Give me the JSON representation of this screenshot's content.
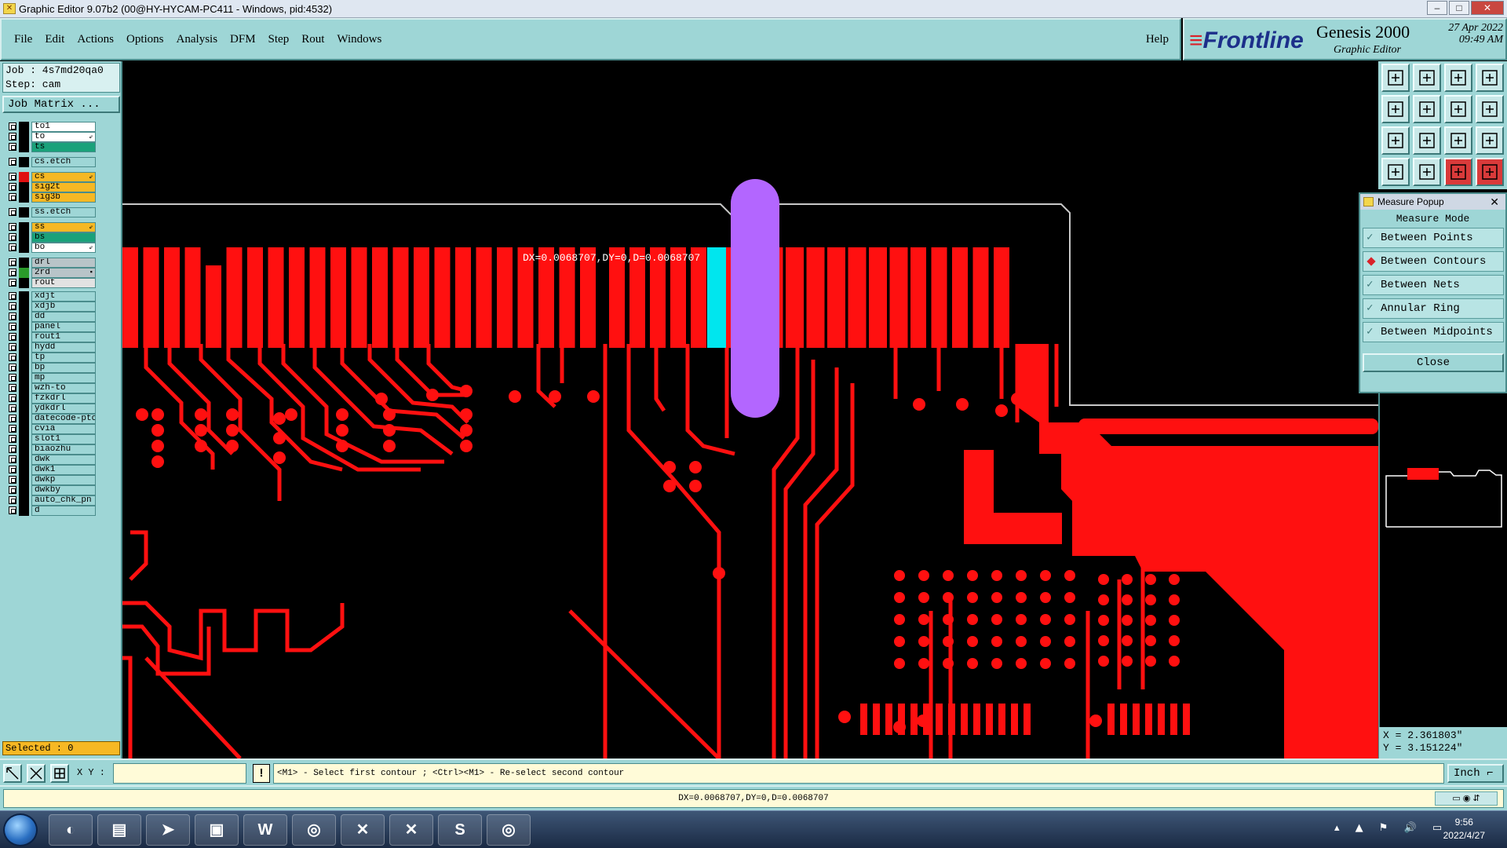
{
  "window": {
    "title": "Graphic Editor 9.07b2 (00@HY-HYCAM-PC411 - Windows, pid:4532)",
    "controls": [
      "–",
      "□",
      "✕"
    ]
  },
  "menu": {
    "items": [
      "File",
      "Edit",
      "Actions",
      "Options",
      "Analysis",
      "DFM",
      "Step",
      "Rout",
      "Windows"
    ],
    "help": "Help"
  },
  "brand": {
    "logo": "Frontline",
    "product": "Genesis 2000",
    "subtitle": "Graphic Editor",
    "date": "27 Apr 2022",
    "time": "09:49 AM"
  },
  "job": {
    "job_line": "Job : 4s7md20qa0",
    "step_line": "Step: cam",
    "matrix_button": "Job Matrix ..."
  },
  "layers": [
    {
      "name": "to1",
      "color": "#ffffff",
      "swatch": "#000000",
      "arrow": ""
    },
    {
      "name": "to",
      "color": "#ffffff",
      "swatch": "#000000",
      "arrow": "⇙"
    },
    {
      "name": "ts",
      "color": "#1aa17a",
      "swatch": "#000000",
      "arrow": ""
    },
    {
      "name": "cs.etch",
      "color": "#9ed6d6",
      "swatch": "#000000",
      "arrow": ""
    },
    {
      "name": "cs",
      "color": "#f6b824",
      "swatch": "#e01010",
      "arrow": "⇙"
    },
    {
      "name": "sig2t",
      "color": "#f6b824",
      "swatch": "#000000",
      "arrow": ""
    },
    {
      "name": "sig3b",
      "color": "#f6b824",
      "swatch": "#000000",
      "arrow": ""
    },
    {
      "name": "ss.etch",
      "color": "#9ed6d6",
      "swatch": "#000000",
      "arrow": ""
    },
    {
      "name": "ss",
      "color": "#f6b824",
      "swatch": "#000000",
      "arrow": "⇙"
    },
    {
      "name": "bs",
      "color": "#1aa17a",
      "swatch": "#000000",
      "arrow": ""
    },
    {
      "name": "bo",
      "color": "#ffffff",
      "swatch": "#000000",
      "arrow": "⇙"
    },
    {
      "name": "drl",
      "color": "#b8c4c8",
      "swatch": "#000000",
      "arrow": ""
    },
    {
      "name": "2rd",
      "color": "#b8c4c8",
      "swatch": "#2a9a2a",
      "arrow": "▪"
    },
    {
      "name": "rout",
      "color": "#e2e2e2",
      "swatch": "#000000",
      "arrow": ""
    },
    {
      "name": "xdjt",
      "color": "#9ed6d6",
      "swatch": "#000000",
      "arrow": ""
    },
    {
      "name": "xdjb",
      "color": "#9ed6d6",
      "swatch": "#000000",
      "arrow": ""
    },
    {
      "name": "dd",
      "color": "#9ed6d6",
      "swatch": "#000000",
      "arrow": ""
    },
    {
      "name": "panel",
      "color": "#9ed6d6",
      "swatch": "#000000",
      "arrow": ""
    },
    {
      "name": "rout1",
      "color": "#9ed6d6",
      "swatch": "#000000",
      "arrow": ""
    },
    {
      "name": "hydd",
      "color": "#9ed6d6",
      "swatch": "#000000",
      "arrow": ""
    },
    {
      "name": "tp",
      "color": "#9ed6d6",
      "swatch": "#000000",
      "arrow": ""
    },
    {
      "name": "bp",
      "color": "#9ed6d6",
      "swatch": "#000000",
      "arrow": ""
    },
    {
      "name": "mp",
      "color": "#9ed6d6",
      "swatch": "#000000",
      "arrow": ""
    },
    {
      "name": "wzh-to",
      "color": "#9ed6d6",
      "swatch": "#000000",
      "arrow": ""
    },
    {
      "name": "fzkdrl",
      "color": "#9ed6d6",
      "swatch": "#000000",
      "arrow": ""
    },
    {
      "name": "ydkdrl",
      "color": "#9ed6d6",
      "swatch": "#000000",
      "arrow": ""
    },
    {
      "name": "datecode-pto",
      "color": "#9ed6d6",
      "swatch": "#000000",
      "arrow": ""
    },
    {
      "name": "cvia",
      "color": "#9ed6d6",
      "swatch": "#000000",
      "arrow": ""
    },
    {
      "name": "slot1",
      "color": "#9ed6d6",
      "swatch": "#000000",
      "arrow": ""
    },
    {
      "name": "biaozhu",
      "color": "#9ed6d6",
      "swatch": "#000000",
      "arrow": ""
    },
    {
      "name": "dwk",
      "color": "#9ed6d6",
      "swatch": "#000000",
      "arrow": ""
    },
    {
      "name": "dwk1",
      "color": "#9ed6d6",
      "swatch": "#000000",
      "arrow": ""
    },
    {
      "name": "dwkp",
      "color": "#9ed6d6",
      "swatch": "#000000",
      "arrow": ""
    },
    {
      "name": "dwkby",
      "color": "#9ed6d6",
      "swatch": "#000000",
      "arrow": ""
    },
    {
      "name": "auto_chk_pn",
      "color": "#9ed6d6",
      "swatch": "#000000",
      "arrow": ""
    },
    {
      "name": "d",
      "color": "#9ed6d6",
      "swatch": "#000000",
      "arrow": ""
    }
  ],
  "selected_label": "Selected : 0",
  "canvas": {
    "measure_text": "DX=0.0068707,DY=0,D=0.0068707",
    "colors": {
      "copper": "#ff1010",
      "highlight": "#00e6ee",
      "slot": "#b366ff",
      "outline": "#c8c8c8"
    }
  },
  "measure_popup": {
    "title": "Measure Popup",
    "mode_label": "Measure Mode",
    "options": [
      {
        "label": "Between Points",
        "selected": false
      },
      {
        "label": "Between Contours",
        "selected": true
      },
      {
        "label": "Between Nets",
        "selected": false
      },
      {
        "label": "Annular Ring",
        "selected": false
      },
      {
        "label": "Between Midpoints",
        "selected": false
      }
    ],
    "close_label": "Close"
  },
  "coords": {
    "x": "X = 2.361803\"",
    "y": "Y = 3.151224\""
  },
  "command": {
    "xy_label": "X Y :",
    "xy_value": "",
    "hint": "<M1> - Select first contour ; <Ctrl><M1> - Re-select second contour",
    "unit": "Inch"
  },
  "status_message": "DX=0.0068707,DY=0,D=0.0068707",
  "taskbar": {
    "apps": [
      "shell",
      "notepad",
      "feather",
      "save",
      "W",
      "eye",
      "X",
      "X",
      "S",
      "eye"
    ],
    "time": "9:56",
    "date": "2022/4/27"
  }
}
